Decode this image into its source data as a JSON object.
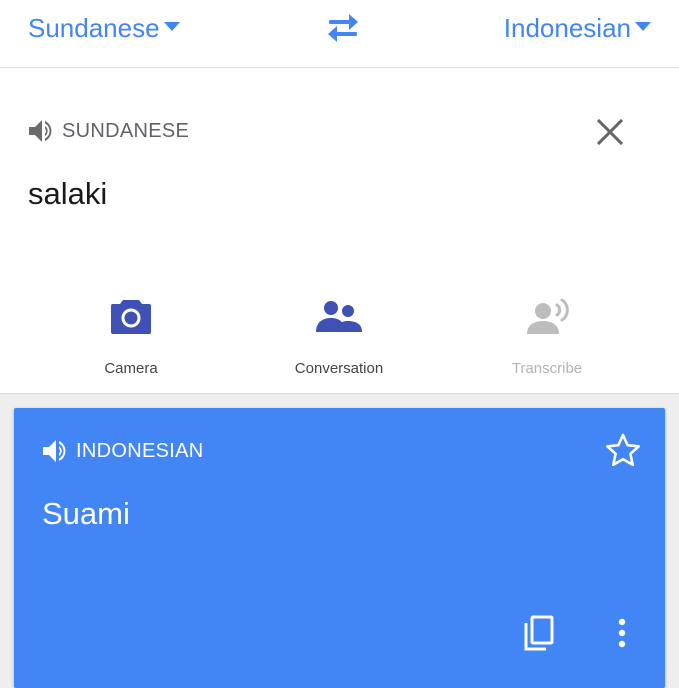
{
  "header": {
    "source_language": "Sundanese",
    "target_language": "Indonesian"
  },
  "source": {
    "language_label": "SUNDANESE",
    "text": "salaki"
  },
  "tools": [
    {
      "label": "Camera",
      "icon": "camera-icon",
      "enabled": true
    },
    {
      "label": "Conversation",
      "icon": "conversation-icon",
      "enabled": true
    },
    {
      "label": "Transcribe",
      "icon": "transcribe-icon",
      "enabled": false
    }
  ],
  "result": {
    "language_label": "INDONESIAN",
    "text": "Suami"
  },
  "colors": {
    "accent": "#4285f4",
    "tool_icon": "#3f51b5",
    "disabled": "#b4b4b4",
    "icon_gray": "#6b6b6b"
  }
}
